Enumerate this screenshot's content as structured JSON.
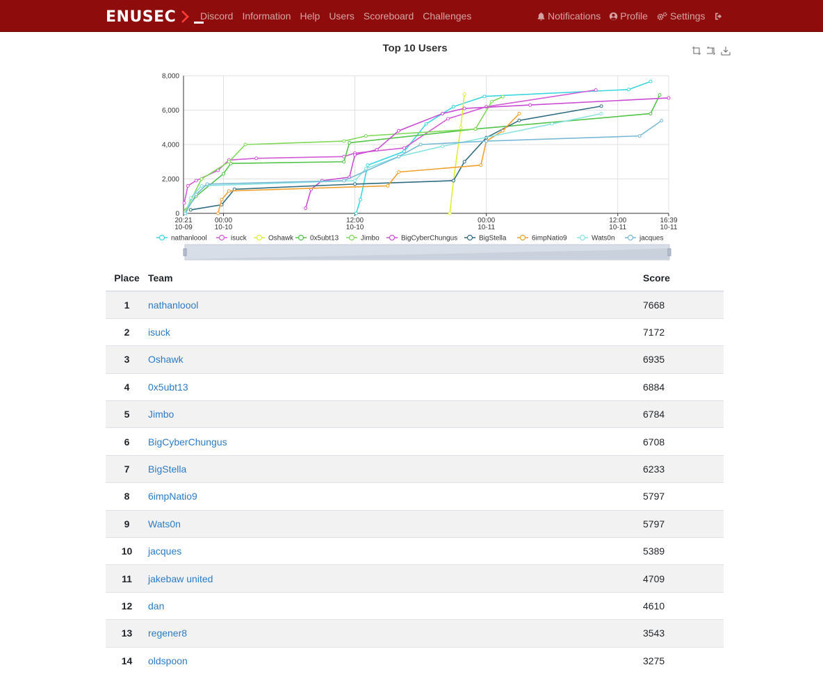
{
  "brand": {
    "name": "ENUSEC"
  },
  "nav": {
    "left": [
      "Discord",
      "Information",
      "Help",
      "Users",
      "Scoreboard",
      "Challenges"
    ],
    "right": [
      {
        "label": "Notifications",
        "icon": "bell-icon"
      },
      {
        "label": "Profile",
        "icon": "user-circle-icon"
      },
      {
        "label": "Settings",
        "icon": "cogs-icon"
      },
      {
        "label": "",
        "icon": "logout-icon"
      }
    ]
  },
  "colors": {
    "navbar": "#8f0c0c",
    "link": "#2b7bc4"
  },
  "chart_data": {
    "type": "line",
    "title": "Top 10 Users",
    "xaxis": {
      "type": "time",
      "range": [
        "10-09 20:21",
        "10-11 16:39"
      ],
      "ticks": [
        {
          "line1": "20:21",
          "line2": "10-09"
        },
        {
          "line1": "00:00",
          "line2": "10-10"
        },
        {
          "line1": "12:00",
          "line2": "10-10"
        },
        {
          "line1": "00:00",
          "line2": "10-11"
        },
        {
          "line1": "12:00",
          "line2": "10-11"
        },
        {
          "line1": "16:39",
          "line2": "10-11"
        }
      ]
    },
    "yaxis": {
      "range": [
        0,
        8000
      ],
      "ticks": [
        "0",
        "2,000",
        "4,000",
        "6,000",
        "8,000"
      ]
    },
    "grid": true,
    "legend": "bottom",
    "series": [
      {
        "name": "nathanloool",
        "color": "#3ad6e0",
        "points": [
          [
            "10-10 12:07",
            0
          ],
          [
            "10-10 12:30",
            800
          ],
          [
            "10-10 13:10",
            2800
          ],
          [
            "10-10 16:30",
            3600
          ],
          [
            "10-10 18:30",
            5200
          ],
          [
            "10-10 21:00",
            6200
          ],
          [
            "10-10 23:50",
            6800
          ],
          [
            "10-11 13:00",
            7200
          ],
          [
            "10-11 15:00",
            7668
          ]
        ]
      },
      {
        "name": "isuck",
        "color": "#d35ad6",
        "points": [
          [
            "10-09 20:25",
            600
          ],
          [
            "10-09 20:45",
            1600
          ],
          [
            "10-09 21:30",
            1900
          ],
          [
            "10-09 23:30",
            2500
          ],
          [
            "10-10 00:30",
            3100
          ],
          [
            "10-10 03:00",
            3200
          ],
          [
            "10-10 11:00",
            3300
          ],
          [
            "10-10 12:00",
            3500
          ],
          [
            "10-10 16:30",
            3800
          ],
          [
            "10-10 20:30",
            5500
          ],
          [
            "10-11 00:00",
            6200
          ],
          [
            "10-11 10:00",
            7172
          ]
        ]
      },
      {
        "name": "Oshawk",
        "color": "#ddee33",
        "points": [
          [
            "10-10 20:40",
            0
          ],
          [
            "10-10 21:00",
            1900
          ],
          [
            "10-10 21:40",
            5000
          ],
          [
            "10-10 22:00",
            6935
          ]
        ]
      },
      {
        "name": "0x5ubt13",
        "color": "#52c449",
        "points": [
          [
            "10-09 20:35",
            200
          ],
          [
            "10-09 21:30",
            1000
          ],
          [
            "10-10 00:00",
            2300
          ],
          [
            "10-10 00:40",
            2900
          ],
          [
            "10-10 11:00",
            3000
          ],
          [
            "10-10 11:30",
            4100
          ],
          [
            "10-10 23:00",
            4900
          ],
          [
            "10-11 15:00",
            5800
          ],
          [
            "10-11 15:50",
            6884
          ]
        ]
      },
      {
        "name": "Jimbo",
        "color": "#7ed957",
        "points": [
          [
            "10-09 20:30",
            100
          ],
          [
            "10-09 22:00",
            2000
          ],
          [
            "10-10 00:30",
            3000
          ],
          [
            "10-10 02:00",
            4000
          ],
          [
            "10-10 11:00",
            4200
          ],
          [
            "10-10 13:00",
            4500
          ],
          [
            "10-10 23:00",
            4900
          ],
          [
            "10-11 00:30",
            6500
          ],
          [
            "10-11 01:30",
            6784
          ]
        ]
      },
      {
        "name": "BigCyberChungus",
        "color": "#c94bd3",
        "points": [
          [
            "10-10 07:30",
            300
          ],
          [
            "10-10 08:00",
            1400
          ],
          [
            "10-10 09:00",
            1900
          ],
          [
            "10-10 11:30",
            2100
          ],
          [
            "10-10 12:00",
            3400
          ],
          [
            "10-10 14:00",
            3700
          ],
          [
            "10-10 16:00",
            4800
          ],
          [
            "10-10 20:00",
            5800
          ],
          [
            "10-10 22:00",
            6100
          ],
          [
            "10-11 04:00",
            6300
          ],
          [
            "10-11 16:39",
            6708
          ]
        ]
      },
      {
        "name": "BigStella",
        "color": "#2f6b7f",
        "points": [
          [
            "10-09 21:00",
            200
          ],
          [
            "10-09 23:50",
            500
          ],
          [
            "10-10 01:00",
            1400
          ],
          [
            "10-10 12:00",
            1700
          ],
          [
            "10-10 21:00",
            1900
          ],
          [
            "10-10 22:00",
            3000
          ],
          [
            "10-11 00:00",
            4400
          ],
          [
            "10-11 03:00",
            5400
          ],
          [
            "10-11 10:30",
            6233
          ]
        ]
      },
      {
        "name": "6impNatio9",
        "color": "#f0a030",
        "points": [
          [
            "10-09 23:30",
            0
          ],
          [
            "10-09 23:50",
            800
          ],
          [
            "10-10 00:30",
            1300
          ],
          [
            "10-10 15:00",
            1600
          ],
          [
            "10-10 16:00",
            2400
          ],
          [
            "10-10 23:30",
            2800
          ],
          [
            "10-11 00:00",
            4200
          ],
          [
            "10-11 01:30",
            4800
          ],
          [
            "10-11 03:00",
            5797
          ]
        ]
      },
      {
        "name": "Wats0n",
        "color": "#8ae3e0",
        "points": [
          [
            "10-09 20:35",
            0
          ],
          [
            "10-09 21:00",
            900
          ],
          [
            "10-09 22:00",
            1600
          ],
          [
            "10-10 12:00",
            1900
          ],
          [
            "10-10 13:00",
            2600
          ],
          [
            "10-10 16:00",
            3300
          ],
          [
            "10-10 20:00",
            3900
          ],
          [
            "10-11 06:00",
            5200
          ],
          [
            "10-11 10:30",
            5797
          ]
        ]
      },
      {
        "name": "jacques",
        "color": "#78b9d6",
        "points": [
          [
            "10-09 20:30",
            0
          ],
          [
            "10-09 21:30",
            1100
          ],
          [
            "10-09 22:30",
            1700
          ],
          [
            "10-10 11:00",
            1900
          ],
          [
            "10-10 16:00",
            3300
          ],
          [
            "10-10 18:00",
            4000
          ],
          [
            "10-11 00:00",
            4200
          ],
          [
            "10-11 14:00",
            4500
          ],
          [
            "10-11 16:00",
            5389
          ]
        ]
      }
    ]
  },
  "table": {
    "headers": {
      "place": "Place",
      "team": "Team",
      "score": "Score"
    },
    "rows": [
      {
        "place": "1",
        "team": "nathanloool",
        "score": "7668"
      },
      {
        "place": "2",
        "team": "isuck",
        "score": "7172"
      },
      {
        "place": "3",
        "team": "Oshawk",
        "score": "6935"
      },
      {
        "place": "4",
        "team": "0x5ubt13",
        "score": "6884"
      },
      {
        "place": "5",
        "team": "Jimbo",
        "score": "6784"
      },
      {
        "place": "6",
        "team": "BigCyberChungus",
        "score": "6708"
      },
      {
        "place": "7",
        "team": "BigStella",
        "score": "6233"
      },
      {
        "place": "8",
        "team": "6impNatio9",
        "score": "5797"
      },
      {
        "place": "9",
        "team": "Wats0n",
        "score": "5797"
      },
      {
        "place": "10",
        "team": "jacques",
        "score": "5389"
      },
      {
        "place": "11",
        "team": "jakebaw united",
        "score": "4709"
      },
      {
        "place": "12",
        "team": "dan",
        "score": "4610"
      },
      {
        "place": "13",
        "team": "regener8",
        "score": "3543"
      },
      {
        "place": "14",
        "team": "oldspoon",
        "score": "3275"
      }
    ]
  }
}
